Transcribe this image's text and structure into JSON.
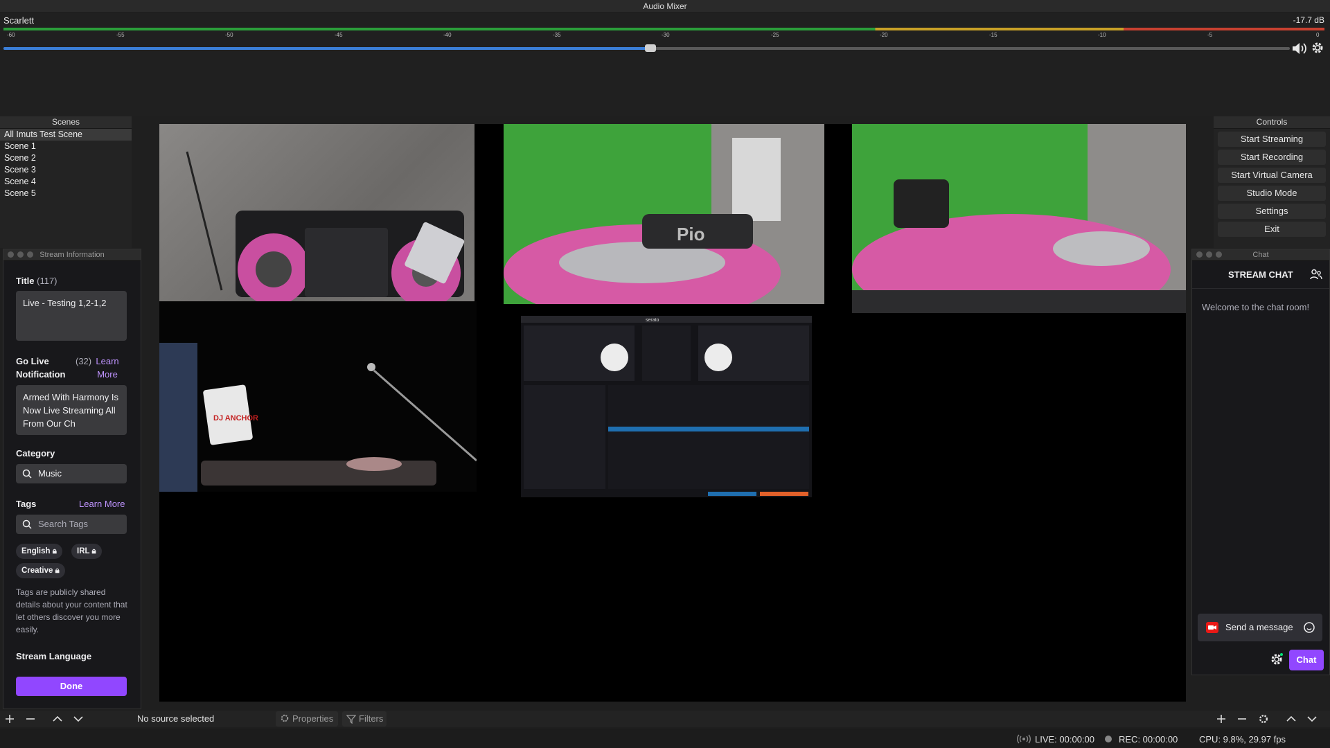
{
  "mixer": {
    "title": "Audio Mixer",
    "source": "Scarlett",
    "level": "-17.7 dB",
    "ticks": [
      "-60",
      "-55",
      "-50",
      "-45",
      "-40",
      "-35",
      "-30",
      "-25",
      "-20",
      "-15",
      "-10",
      "-5",
      "0"
    ],
    "volume_fraction": 0.503,
    "meter_colors": {
      "green": "#2b9e3a",
      "yellow": "#c8a127",
      "red": "#c84130"
    },
    "icons": [
      "speaker-icon",
      "gear-icon"
    ]
  },
  "scenes": {
    "title": "Scenes",
    "items": [
      "All Imuts Test Scene",
      "Scene 1",
      "Scene 2",
      "Scene 3",
      "Scene 4",
      "Scene 5"
    ]
  },
  "stream_info": {
    "window_title": "Stream Information",
    "title_label": "Title",
    "title_count": "(117)",
    "title_value": "Live - Testing 1,2-1,2",
    "go_live_label_1": "Go Live",
    "go_live_label_2": "Notification",
    "go_live_count": "(32)",
    "go_live_learn_1": "Learn",
    "go_live_learn_2": "More",
    "notification_value": "Armed With Harmony Is Now Live Streaming All From Our Ch",
    "category_label": "Category",
    "category_value": "Music",
    "tags_label": "Tags",
    "tags_learn": "Learn More",
    "tags_placeholder": "Search Tags",
    "tags": [
      "English",
      "IRL",
      "Creative"
    ],
    "tags_help": "Tags are publicly shared details about your content that let others discover you more easily.",
    "language_label": "Stream Language",
    "done_label": "Done",
    "accent": "#9147ff"
  },
  "controls": {
    "title": "Controls",
    "buttons": [
      "Start Streaming",
      "Start Recording",
      "Start Virtual Camera",
      "Studio Mode",
      "Settings",
      "Exit"
    ]
  },
  "chat": {
    "window_title": "Chat",
    "header": "STREAM CHAT",
    "welcome": "Welcome to the chat room!",
    "input_placeholder": "Send a message",
    "send_label": "Chat"
  },
  "sources_toolbar": {
    "no_source": "No source selected",
    "properties": "Properties",
    "filters": "Filters"
  },
  "status": {
    "live": "LIVE: 00:00:00",
    "rec": "REC: 00:00:00",
    "cpu": "CPU: 9.8%, 29.97 fps"
  },
  "preview": {
    "dj_sticker": "DJ ANCHOR",
    "turntable_brand": "Pio",
    "software": "serato"
  }
}
